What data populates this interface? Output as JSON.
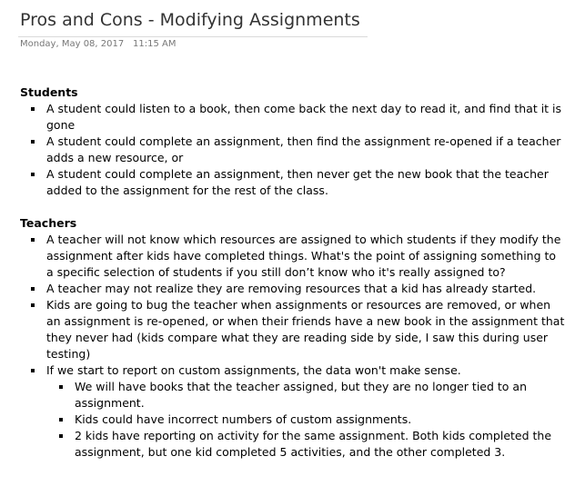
{
  "page": {
    "title": "Pros and Cons - Modifying Assignments",
    "date": "Monday, May 08, 2017",
    "time": "11:15 AM"
  },
  "sections": {
    "students": {
      "heading": "Students",
      "items": [
        "A student could listen to a book, then come back the next day to read it, and find that it is gone",
        "A student could complete an assignment, then find the assignment re-opened if a teacher adds a new resource, or",
        "A student could complete an assignment, then never get the new book that the teacher added to the assignment for the rest of the class."
      ]
    },
    "teachers": {
      "heading": "Teachers",
      "items": [
        "A teacher will not know which resources are assigned to which students if they modify the assignment after kids have completed things.  What's the point of assigning something to a specific selection of students if you still don’t know who it's really assigned to?",
        "A teacher may not realize they are removing resources that a kid has already started.",
        "Kids are going to bug the teacher when assignments or resources are removed, or when an assignment is re-opened, or when their friends have a new book in the assignment that they never had (kids compare what they are reading side by side, I saw this during user testing)",
        "If we start to report on custom assignments, the data won't make sense."
      ],
      "sub_items": [
        "We will have books that the teacher assigned, but they are no longer tied to an assignment.",
        "Kids could have incorrect numbers of custom assignments.",
        "2 kids have reporting on activity for the same assignment. Both kids completed the assignment, but one kid completed 5 activities, and the other completed 3."
      ]
    }
  }
}
